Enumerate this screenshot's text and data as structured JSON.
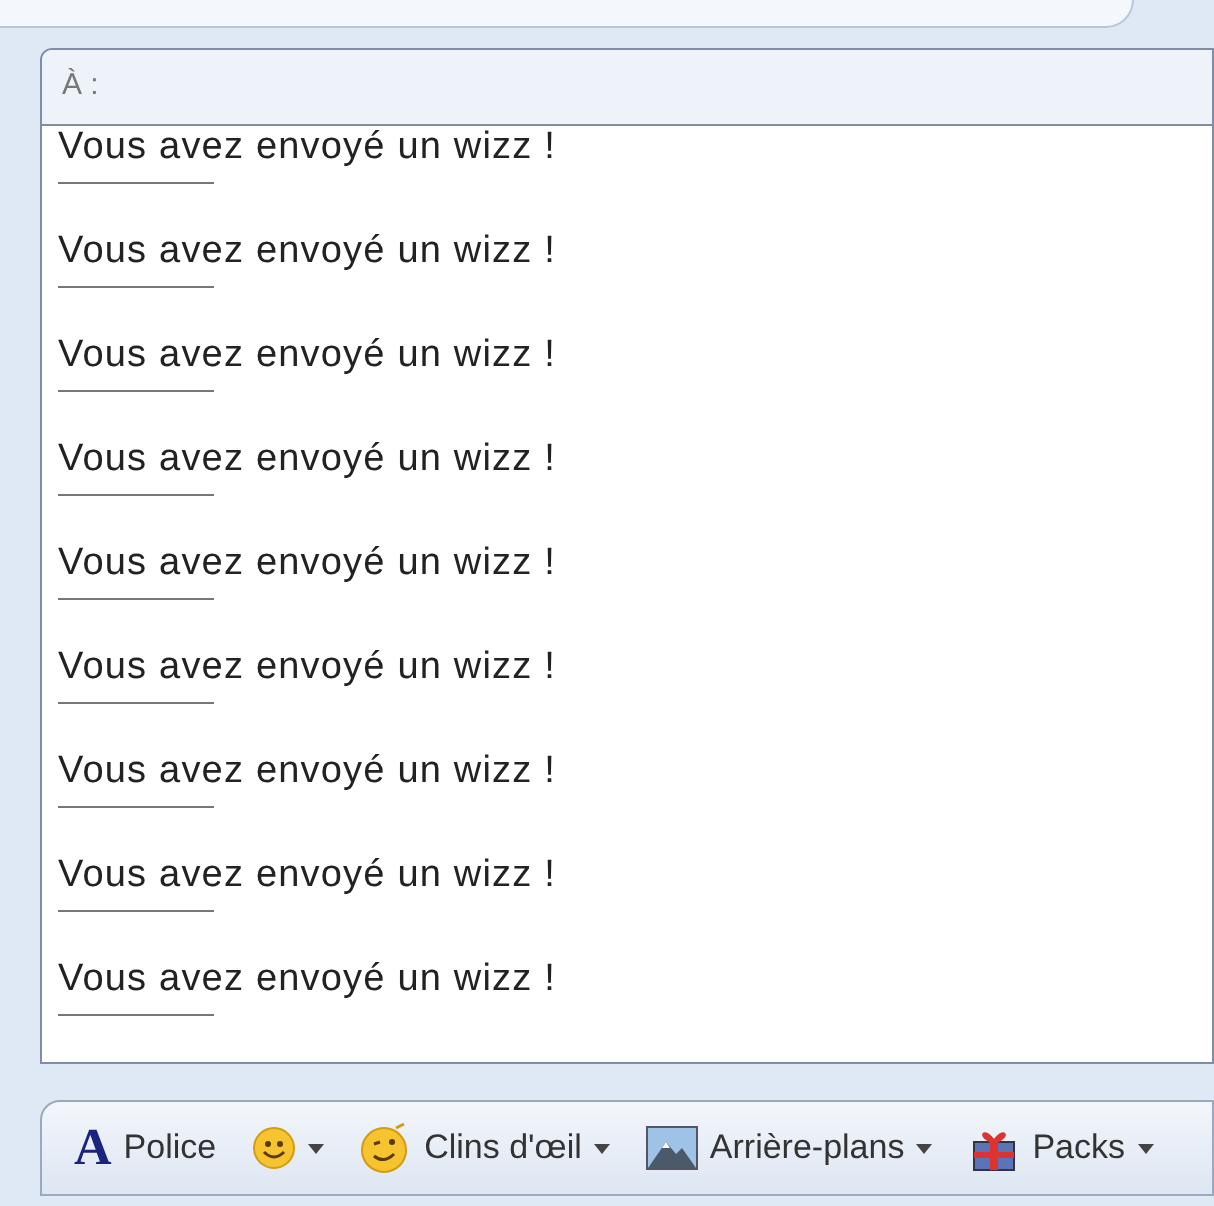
{
  "recipient_label": "À :",
  "messages": [
    {
      "text": "Vous avez envoyé un wizz !"
    },
    {
      "text": "Vous avez envoyé un wizz !"
    },
    {
      "text": "Vous avez envoyé un wizz !"
    },
    {
      "text": "Vous avez envoyé un wizz !"
    },
    {
      "text": "Vous avez envoyé un wizz !"
    },
    {
      "text": "Vous avez envoyé un wizz !"
    },
    {
      "text": "Vous avez envoyé un wizz !"
    },
    {
      "text": "Vous avez envoyé un wizz !"
    },
    {
      "text": "Vous avez envoyé un wizz !"
    }
  ],
  "toolbar": [
    {
      "kind": "font",
      "icon_text": "A",
      "label": "Police",
      "dropdown": false
    },
    {
      "kind": "emoticon",
      "dropdown": true
    },
    {
      "kind": "wink",
      "label": "Clins d'œil",
      "dropdown": true
    },
    {
      "kind": "background",
      "label": "Arrière-plans",
      "dropdown": true
    },
    {
      "kind": "gift",
      "label": "Packs",
      "dropdown": true
    }
  ]
}
